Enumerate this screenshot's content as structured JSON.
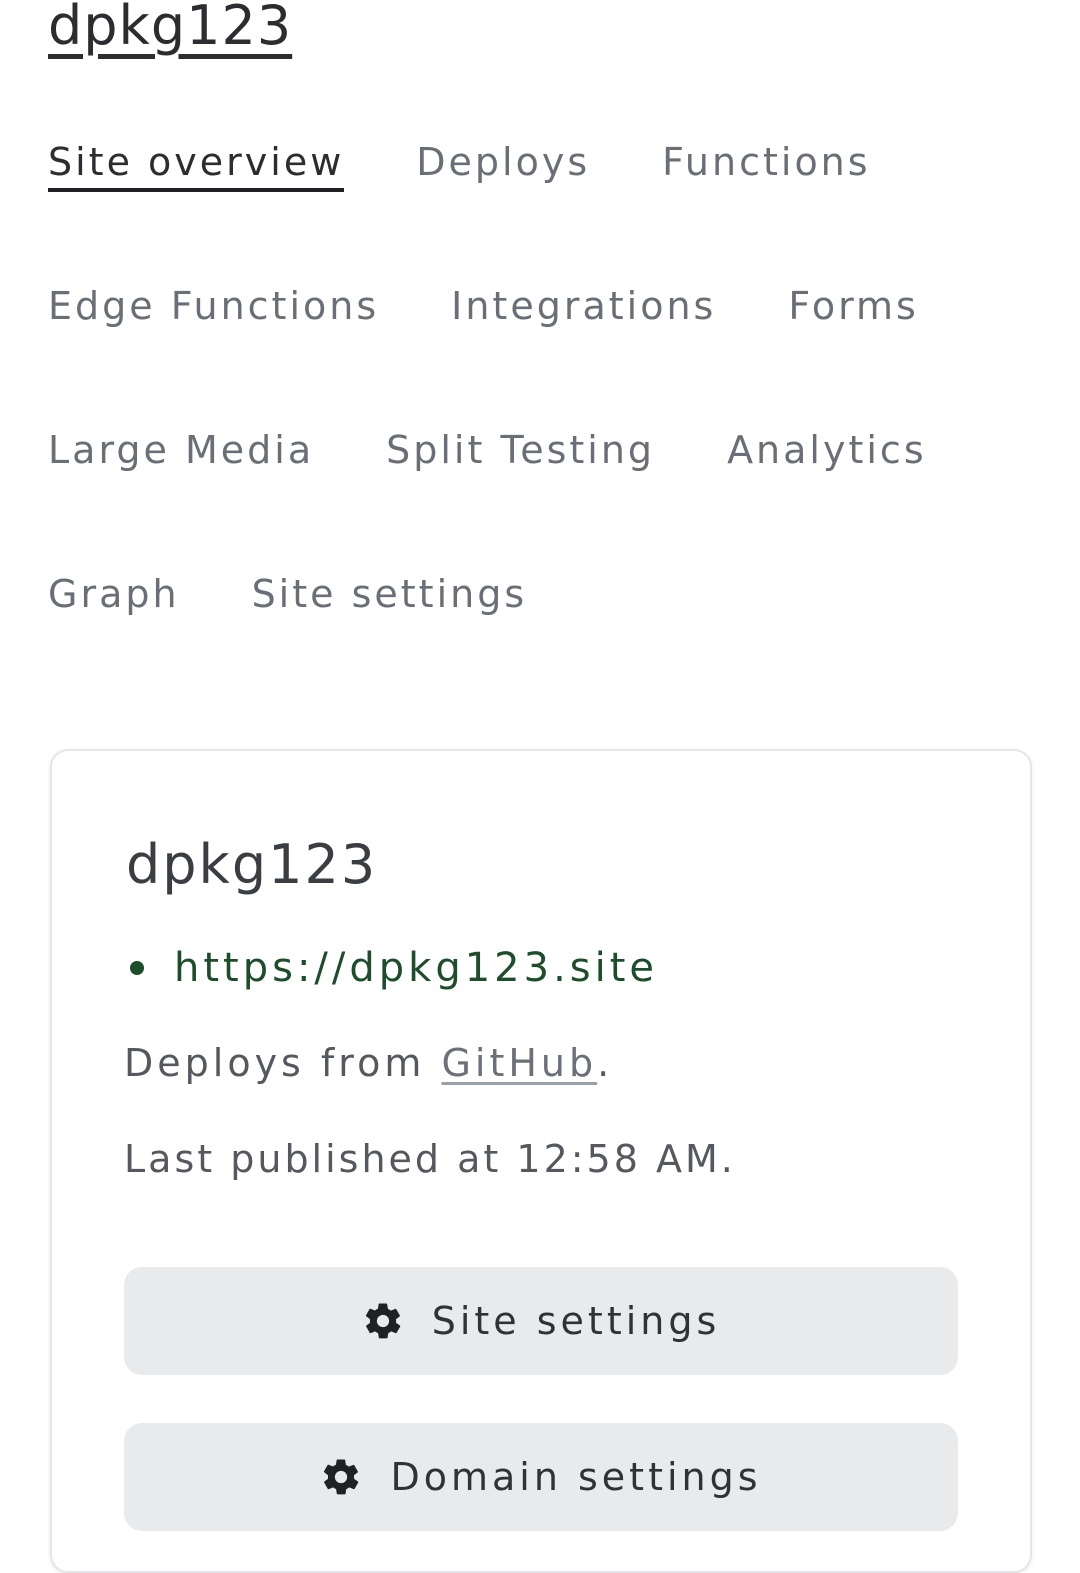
{
  "header": {
    "site_name": "dpkg123"
  },
  "nav": {
    "items": [
      {
        "label": "Site overview",
        "active": true
      },
      {
        "label": "Deploys",
        "active": false
      },
      {
        "label": "Functions",
        "active": false
      },
      {
        "label": "Edge Functions",
        "active": false
      },
      {
        "label": "Integrations",
        "active": false
      },
      {
        "label": "Forms",
        "active": false
      },
      {
        "label": "Large Media",
        "active": false
      },
      {
        "label": "Split Testing",
        "active": false
      },
      {
        "label": "Analytics",
        "active": false
      },
      {
        "label": "Graph",
        "active": false
      },
      {
        "label": "Site settings",
        "active": false
      }
    ]
  },
  "card": {
    "title": "dpkg123",
    "url": "https://dpkg123.site",
    "deploys_prefix": "Deploys from ",
    "deploys_source": "GitHub",
    "deploys_suffix": ".",
    "last_published": "Last published at 12:58 AM.",
    "buttons": {
      "site_settings": {
        "label": "Site settings",
        "icon": "gear-icon"
      },
      "domain_settings": {
        "label": "Domain settings",
        "icon": "gear-icon"
      }
    }
  },
  "colors": {
    "accent_green": "#1d4d2a",
    "button_bg": "#e9eaec",
    "text_dark": "#2b2d31",
    "text_muted": "#6a6e76"
  }
}
